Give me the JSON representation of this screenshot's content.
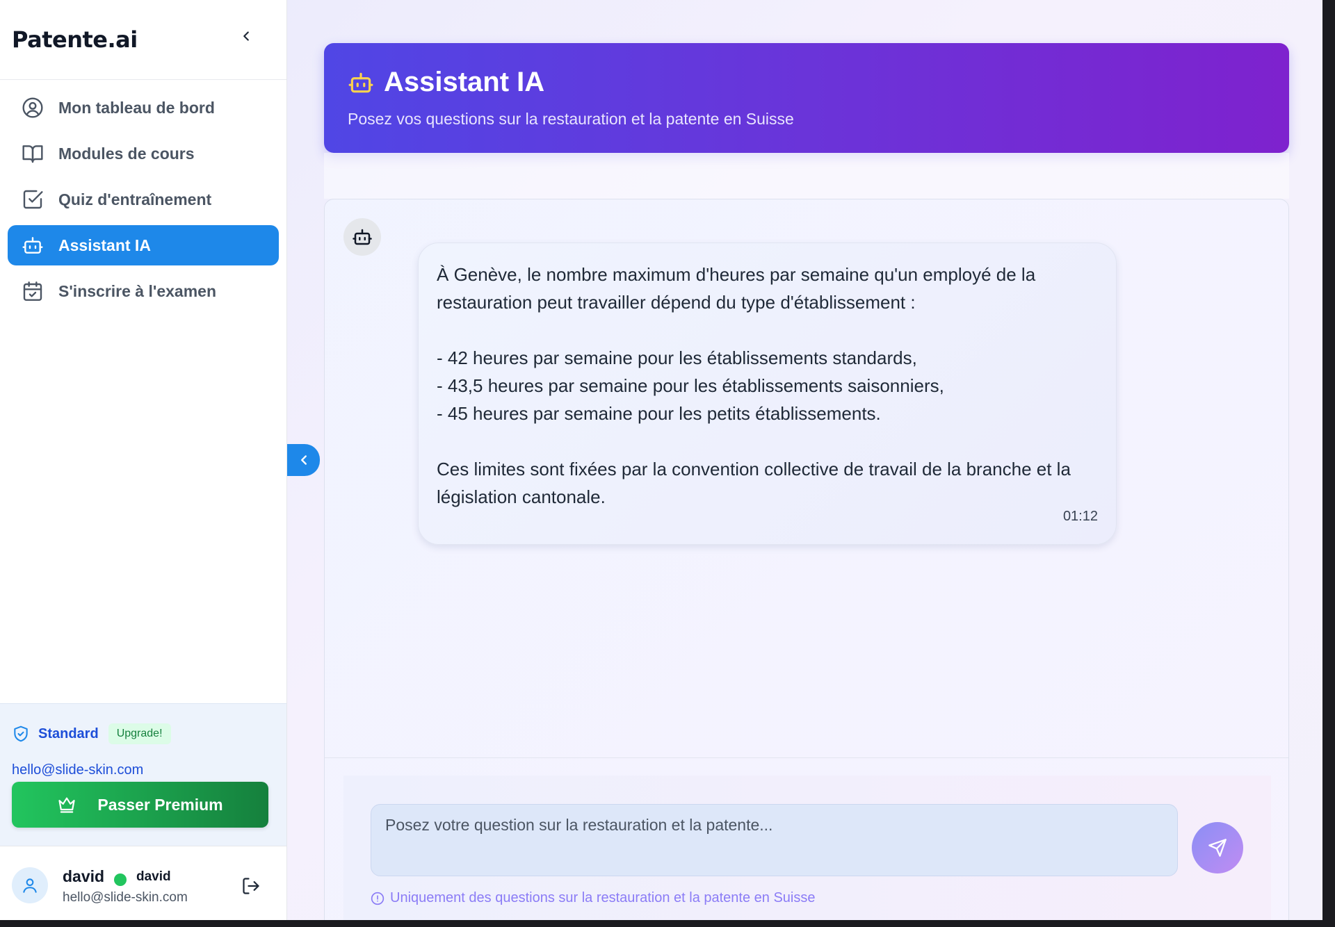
{
  "app": {
    "brand": "Patente.ai"
  },
  "sidebar": {
    "items": [
      {
        "label": "Mon tableau de bord",
        "icon": "user-circle-icon",
        "active": false
      },
      {
        "label": "Modules de cours",
        "icon": "book-icon",
        "active": false
      },
      {
        "label": "Quiz d'entraînement",
        "icon": "checkbox-icon",
        "active": false
      },
      {
        "label": "Assistant IA",
        "icon": "bot-icon",
        "active": true
      },
      {
        "label": "S'inscrire à l'examen",
        "icon": "calendar-check-icon",
        "active": false
      }
    ],
    "plan": {
      "name": "Standard",
      "badge": "Upgrade!",
      "email": "hello@slide-skin.com",
      "premium_label": "Passer Premium"
    },
    "user": {
      "name": "david",
      "handle": "david",
      "email": "hello@slide-skin.com",
      "status": "online"
    }
  },
  "header": {
    "title": "Assistant IA",
    "subtitle": "Posez vos questions sur la restauration et la patente en Suisse"
  },
  "chat": {
    "messages": [
      {
        "sender": "assistant",
        "lines": [
          "À Genève, le nombre maximum d'heures par semaine qu'un employé de la restauration peut travailler dépend du type d'établissement :",
          "- 42 heures par semaine pour les établissements standards,",
          "- 43,5 heures par semaine pour les établissements saisonniers,",
          "- 45 heures par semaine pour les petits établissements.",
          "Ces limites sont fixées par la convention collective de travail de la branche et la législation cantonale."
        ],
        "time": "01:12"
      }
    ],
    "input": {
      "placeholder": "Posez votre question sur la restauration et la patente...",
      "value": ""
    },
    "hint": "Uniquement des questions sur la restauration et la patente en Suisse"
  },
  "colors": {
    "accent": "#1e88e9",
    "hero_start": "#5046e5",
    "hero_end": "#7e22ce",
    "premium_start": "#22c55e",
    "premium_end": "#15803d",
    "online": "#22c55e"
  }
}
